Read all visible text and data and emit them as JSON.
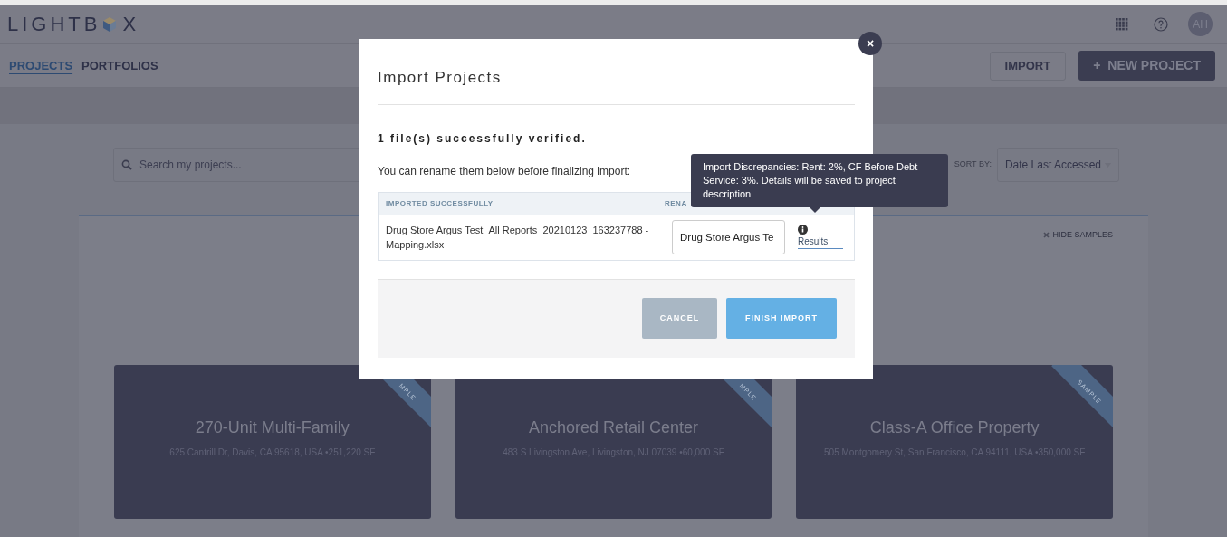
{
  "header": {
    "logo": "LIGHTB",
    "logo_end": "X",
    "avatar": "AH"
  },
  "nav": {
    "tabs": [
      {
        "label": "PROJECTS",
        "selected": true
      },
      {
        "label": "PORTFOLIOS",
        "selected": false
      }
    ],
    "import_button": "IMPORT",
    "new_button": "NEW PROJECT",
    "new_icon": "+"
  },
  "toolbar": {
    "search_placeholder": "Search my projects...",
    "sort_label": "SORT BY:",
    "sort_value": "Date Last Accessed"
  },
  "hide_samples": "HIDE SAMPLES",
  "cards": [
    {
      "title": "270-Unit Multi-Family",
      "address": "625 Cantrill Dr, Davis, CA 95618, USA •251,220 SF",
      "ribbon": "MPLE"
    },
    {
      "title": "Anchored Retail Center",
      "address": "483 S Livingston Ave, Livingston, NJ 07039 •60,000 SF",
      "ribbon": "MPLE"
    },
    {
      "title": "Class-A Office Property",
      "address": "505 Montgomery St, San Francisco, CA 94111, USA •350,000 SF",
      "ribbon": "SAMPLE"
    }
  ],
  "modal": {
    "title": "Import Projects",
    "close": "×",
    "verified": "1 file(s) successfully verified.",
    "instructions": "You can rename them below before finalizing import:",
    "columns": [
      "IMPORTED SUCCESSFULLY",
      "RENA"
    ],
    "rows": [
      {
        "file": "Drug Store Argus Test_All Reports_20210123_163237788 - Mapping.xlsx",
        "rename": "Drug Store Argus Te",
        "compare": "Results"
      }
    ],
    "tooltip": "Import Discrepancies: Rent: 2%, CF Before Debt Service: 3%. Details will be saved to project description",
    "cancel": "CANCEL",
    "finish": "FINISH IMPORT"
  }
}
